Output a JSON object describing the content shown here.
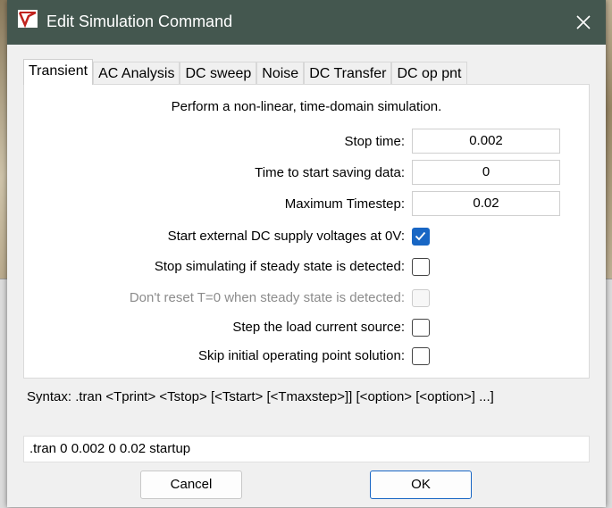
{
  "window": {
    "title": "Edit Simulation Command"
  },
  "tabs": [
    {
      "label": "Transient"
    },
    {
      "label": "AC Analysis"
    },
    {
      "label": "DC sweep"
    },
    {
      "label": "Noise"
    },
    {
      "label": "DC Transfer"
    },
    {
      "label": "DC op pnt"
    }
  ],
  "transient": {
    "description": "Perform a non-linear, time-domain simulation.",
    "fields": [
      {
        "label": "Stop time:",
        "value": "0.002"
      },
      {
        "label": "Time to start saving data:",
        "value": "0"
      },
      {
        "label": "Maximum Timestep:",
        "value": "0.02"
      }
    ],
    "options": [
      {
        "label": "Start external DC supply voltages at 0V:",
        "checked": true,
        "enabled": true
      },
      {
        "label": "Stop simulating if steady state is detected:",
        "checked": false,
        "enabled": true
      },
      {
        "label": "Don't reset T=0 when steady state is detected:",
        "checked": false,
        "enabled": false
      },
      {
        "label": "Step the load current source:",
        "checked": false,
        "enabled": true
      },
      {
        "label": "Skip initial operating point solution:",
        "checked": false,
        "enabled": true
      }
    ]
  },
  "syntax": "Syntax:  .tran <Tprint> <Tstop> [<Tstart> [<Tmaxstep>]] [<option> [<option>] ...]",
  "command": ".tran 0 0.002 0 0.02 startup",
  "buttons": {
    "cancel": "Cancel",
    "ok": "OK"
  },
  "colors": {
    "titlebar": "#44574f",
    "accent": "#1866c4"
  },
  "icons": {
    "app": "ltspice-app-icon",
    "close": "close-icon",
    "check": "check-icon"
  }
}
